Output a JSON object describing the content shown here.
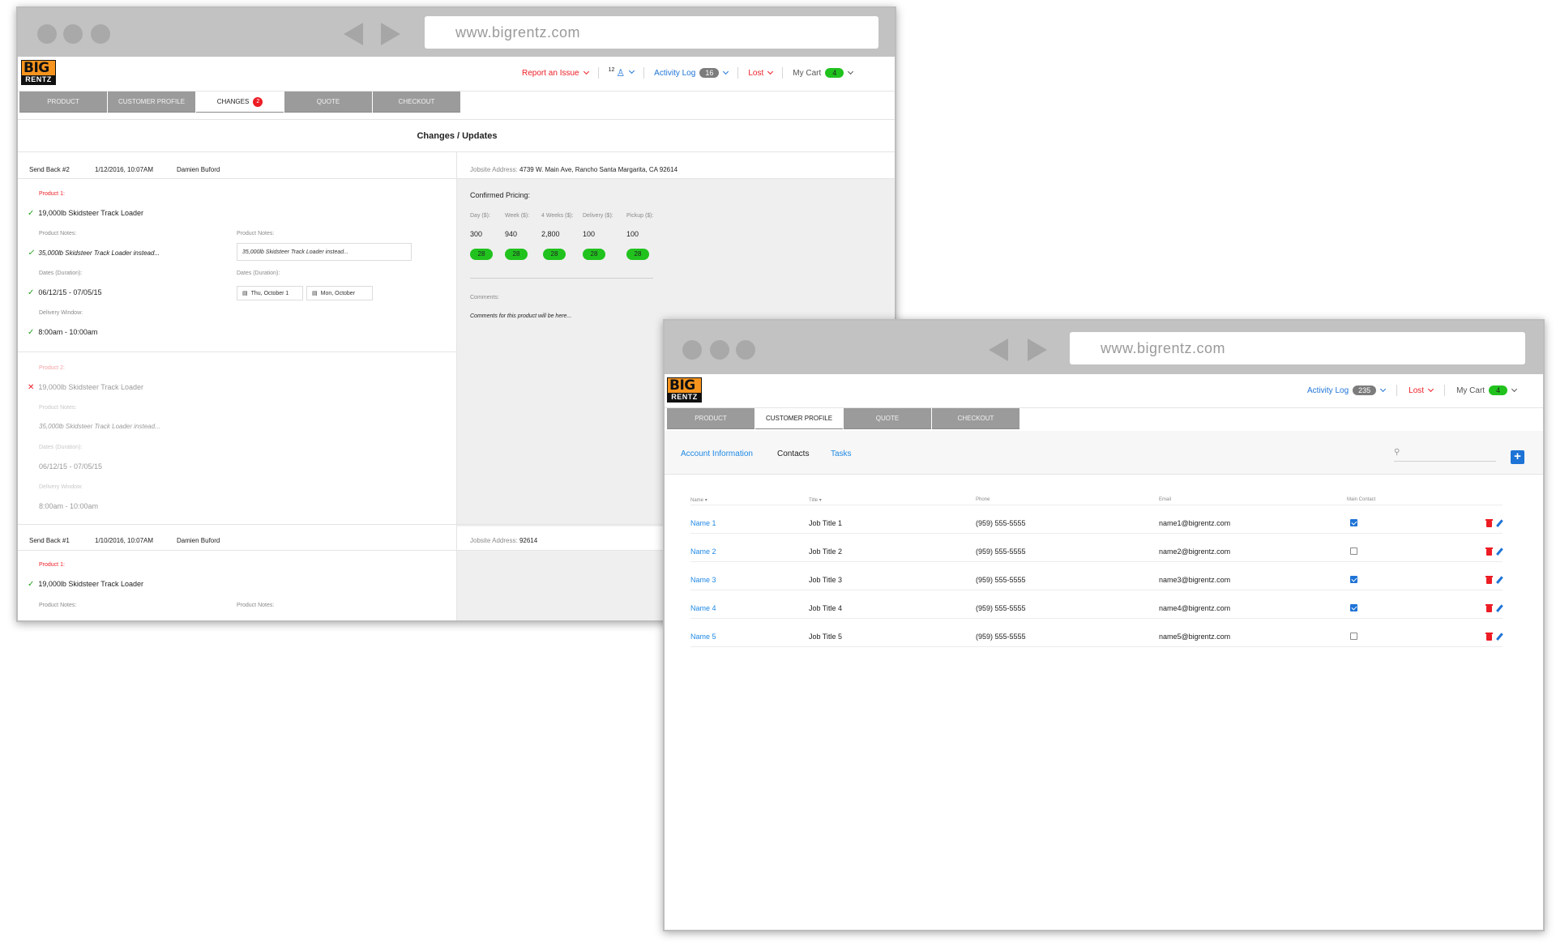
{
  "browser": {
    "url": "www.bigrentz.com"
  },
  "logo": {
    "line1": "BIG",
    "line2": "RENTZ"
  },
  "changes_window": {
    "nav": {
      "report_issue": "Report an Issue",
      "user_count": "12",
      "activity_log_label": "Activity Log",
      "activity_log_count": "16",
      "lost_label": "Lost",
      "cart_label": "My Cart",
      "cart_count": "4"
    },
    "tabs": [
      "PRODUCT",
      "CUSTOMER PROFILE",
      "CHANGES",
      "QUOTE",
      "CHECKOUT"
    ],
    "changes_badge": "2",
    "section_title": "Changes / Updates",
    "send_back_2": {
      "label": "Send Back #2",
      "date": "1/12/2016, 10:07AM",
      "user": "Damien Buford",
      "jobsite_label": "Jobsite Address:",
      "jobsite_value": "4739 W. Main Ave, Rancho Santa Margarita, CA 92614",
      "product1_label": "Product 1:",
      "product1_name": "19,000lb Skidsteer Track Loader",
      "notes_label": "Product Notes:",
      "notes_value": "35,000lb Skidsteer Track Loader instead...",
      "dates_label": "Dates (Duration):",
      "dates_value": "06/12/15 - 07/05/15",
      "date_start": "Thu, October 1",
      "date_end": "Mon, October",
      "delivery_label": "Delivery Window:",
      "delivery_value": "8:00am - 10:00am",
      "product2_label": "Product 2:",
      "product2_name": "19,000lb Skidsteer Track Loader",
      "p2_notes_value": "35,000lb Skidsteer Track Loader instead...",
      "p2_dates_value": "06/12/15 - 07/05/15",
      "p2_delivery_value": "8:00am - 10:00am",
      "pricing_title": "Confirmed Pricing:",
      "pricing_headers": [
        "Day ($):",
        "Week ($):",
        "4 Weeks ($):",
        "Delivery ($):",
        "Pickup ($):"
      ],
      "pricing_values": [
        "300",
        "940",
        "2,800",
        "100",
        "100"
      ],
      "pricing_pills": [
        "28",
        "28",
        "28",
        "28",
        "28"
      ],
      "comments_label": "Comments:",
      "comments_value": "Comments for this product will be here..."
    },
    "send_back_1": {
      "label": "Send Back #1",
      "date": "1/10/2016, 10:07AM",
      "user": "Damien Buford",
      "jobsite_label": "Jobsite Address:",
      "jobsite_value": "92614",
      "product1_label": "Product 1:",
      "product1_name": "19,000lb Skidsteer Track Loader",
      "notes_label": "Product Notes:",
      "notes_label2": "Product Notes:"
    }
  },
  "profile_window": {
    "nav": {
      "activity_log_label": "Activity Log",
      "activity_log_count": "235",
      "lost_label": "Lost",
      "cart_label": "My Cart",
      "cart_count": "4"
    },
    "tabs": [
      "PRODUCT",
      "CUSTOMER PROFILE",
      "QUOTE",
      "CHECKOUT"
    ],
    "subtabs": [
      "Account Information",
      "Contacts",
      "Tasks"
    ],
    "columns": [
      "Name",
      "Title",
      "Phone",
      "Email",
      "Main Contact"
    ],
    "rows": [
      {
        "name": "Name 1",
        "title": "Job Title 1",
        "phone": "(959) 555-5555",
        "email": "name1@bigrentz.com",
        "main": true
      },
      {
        "name": "Name 2",
        "title": "Job Title 2",
        "phone": "(959) 555-5555",
        "email": "name2@bigrentz.com",
        "main": false
      },
      {
        "name": "Name 3",
        "title": "Job Title 3",
        "phone": "(959) 555-5555",
        "email": "name3@bigrentz.com",
        "main": true
      },
      {
        "name": "Name 4",
        "title": "Job Title 4",
        "phone": "(959) 555-5555",
        "email": "name4@bigrentz.com",
        "main": true
      },
      {
        "name": "Name 5",
        "title": "Job Title 5",
        "phone": "(959) 555-5555",
        "email": "name5@bigrentz.com",
        "main": false
      }
    ]
  }
}
